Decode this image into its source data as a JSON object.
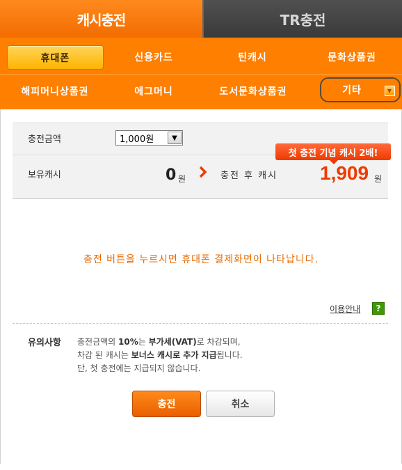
{
  "tabs": {
    "cash_charge": "캐시충전",
    "tr_charge": "TR충전"
  },
  "methods": {
    "row1": [
      "휴대폰",
      "신용카드",
      "틴캐시",
      "문화상품권"
    ],
    "row2": [
      "해피머니상품권",
      "에그머니",
      "도서문화상품권",
      "기타"
    ],
    "active": "휴대폰"
  },
  "charge_form": {
    "amount_label": "충전금액",
    "amount_value": "1,000원",
    "owned_label": "보유캐시",
    "owned_value": "0",
    "unit": "원",
    "after_label": "충전 후 캐시",
    "after_value": "1,909",
    "promo_badge": "첫 충전 기념 캐시 2배!"
  },
  "notice": "충전 버튼을 누르시면 휴대폰 결제화면이 나타납니다.",
  "guide_link": "이용안내",
  "caution": {
    "title": "유의사항",
    "line1_a": "충전금액의 ",
    "line1_b": "10%",
    "line1_c": "는 ",
    "line1_d": "부가세(VAT)",
    "line1_e": "로 차감되며,",
    "line2_a": "차감 된 캐시는 ",
    "line2_b": "보너스 캐시로 추가 지급",
    "line2_c": "됩니다.",
    "line3": "단, 첫 충전에는 지급되지 않습니다."
  },
  "buttons": {
    "charge": "충전",
    "cancel": "취소"
  },
  "colors": {
    "orange": "#ff7f00",
    "tab_dark": "#3a3a3a",
    "promo_red": "#ee3a00",
    "notice_orange": "#e86a00"
  }
}
